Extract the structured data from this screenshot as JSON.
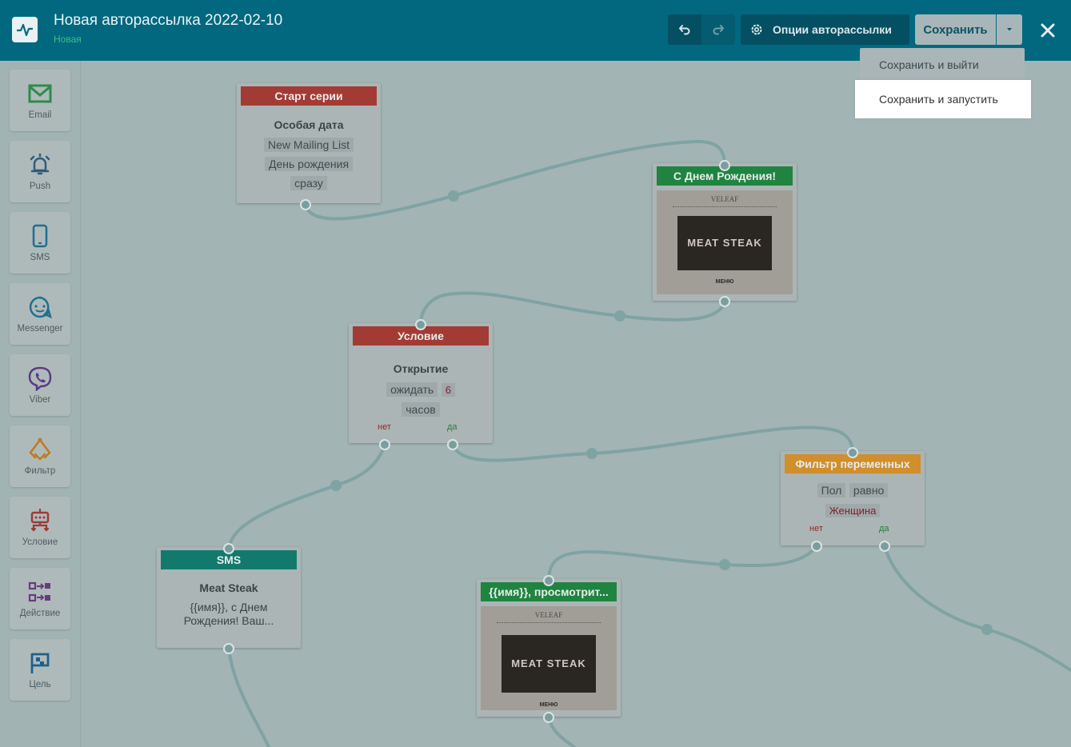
{
  "header": {
    "title": "Новая авторассылка 2022-02-10",
    "status": "Новая",
    "options_label": "Опции авторассылки",
    "save_label": "Сохранить"
  },
  "save_menu": {
    "items": [
      "Сохранить и выйти",
      "Сохранить и запустить"
    ]
  },
  "sidebar": {
    "items": [
      {
        "label": "Email",
        "icon": "envelope-icon",
        "color": "#2f8a4b"
      },
      {
        "label": "Push",
        "icon": "bell-icon",
        "color": "#2f5c7a"
      },
      {
        "label": "SMS",
        "icon": "phone-icon",
        "color": "#1f6f8f"
      },
      {
        "label": "Messenger",
        "icon": "chat-icon",
        "color": "#1f6f8f"
      },
      {
        "label": "Viber",
        "icon": "viber-icon",
        "color": "#5b3a85"
      },
      {
        "label": "Фильтр",
        "icon": "filter-icon",
        "color": "#c07a1c"
      },
      {
        "label": "Условие",
        "icon": "condition-icon",
        "color": "#9c3a36"
      },
      {
        "label": "Действие",
        "icon": "action-icon",
        "color": "#6a3a80"
      },
      {
        "label": "Цель",
        "icon": "flag-icon",
        "color": "#1f5f8a"
      }
    ]
  },
  "nodes": {
    "start": {
      "title": "Старт серии",
      "color": "#a33b35",
      "heading": "Особая дата",
      "chips": [
        "New Mailing List",
        "День рождения",
        "сразу"
      ]
    },
    "email1": {
      "title": "С Днем Рождения!",
      "color": "#1f8440",
      "brand": "VELEAF",
      "hero": "MEAT STEAK",
      "menu": "МЕНЮ"
    },
    "condition": {
      "title": "Условие",
      "color": "#a33b35",
      "heading": "Открытие",
      "wait_label": "ожидать",
      "wait_value": "6",
      "unit": "часов",
      "no": "нет",
      "yes": "да"
    },
    "filter": {
      "title": "Фильтр переменных",
      "color": "#d08e2c",
      "field": "Пол",
      "op": "равно",
      "value": "Женщина",
      "no": "нет",
      "yes": "да"
    },
    "sms": {
      "title": "SMS",
      "color": "#127a6d",
      "heading": "Meat Steak",
      "text": "{{имя}}, с Днем Рождения! Ваш..."
    },
    "email2": {
      "title": "{{имя}}, просмотрит...",
      "color": "#1f8440",
      "brand": "VELEAF",
      "hero": "MEAT STEAK",
      "menu": "МЕНЮ"
    }
  },
  "colors": {
    "header_bg": "#01687f",
    "canvas_bg": "#a3b4b4",
    "edge": "#7fa3a3"
  }
}
